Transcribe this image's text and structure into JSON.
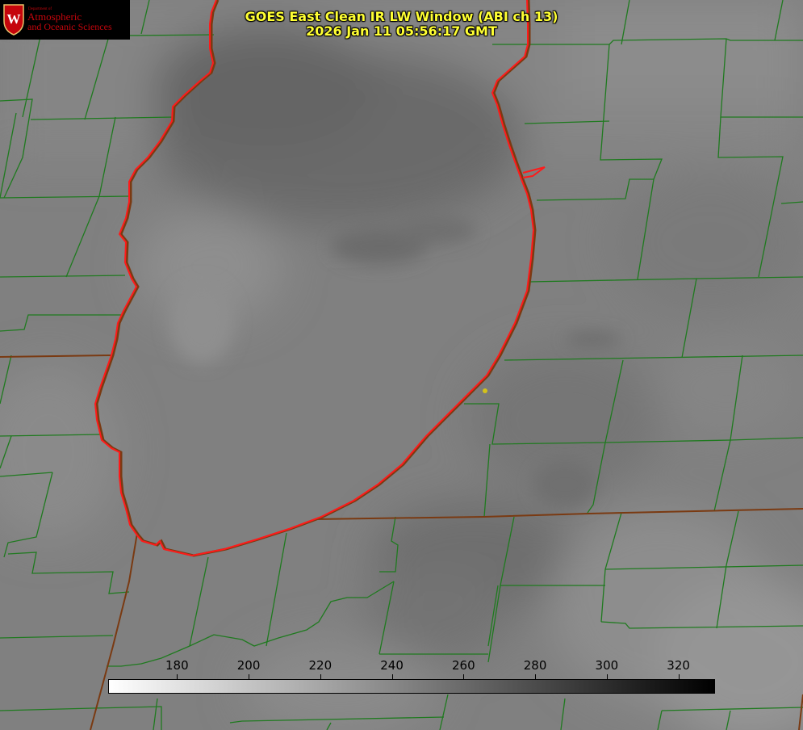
{
  "header": {
    "title": "GOES East Clean IR LW Window (ABI ch 13)",
    "timestamp": "2026 Jan 11 05:56:17 GMT"
  },
  "logo": {
    "department": "Department of",
    "line1": "Atmospheric",
    "line2": "and Oceanic Sciences",
    "seal_letter": "W",
    "color": "#c5050c"
  },
  "colorbar": {
    "min": 161,
    "max": 330,
    "start_color": "#ffffff",
    "end_color": "#000000",
    "ticks": [
      "180",
      "200",
      "220",
      "240",
      "260",
      "280",
      "300",
      "320"
    ]
  },
  "colors": {
    "county_lines": "#1f7a1f",
    "state_lines": "#7a3a12",
    "lake_outline": "#ff1a1a",
    "title_text": "#ffff33",
    "point_marker": "#d4c21a"
  }
}
